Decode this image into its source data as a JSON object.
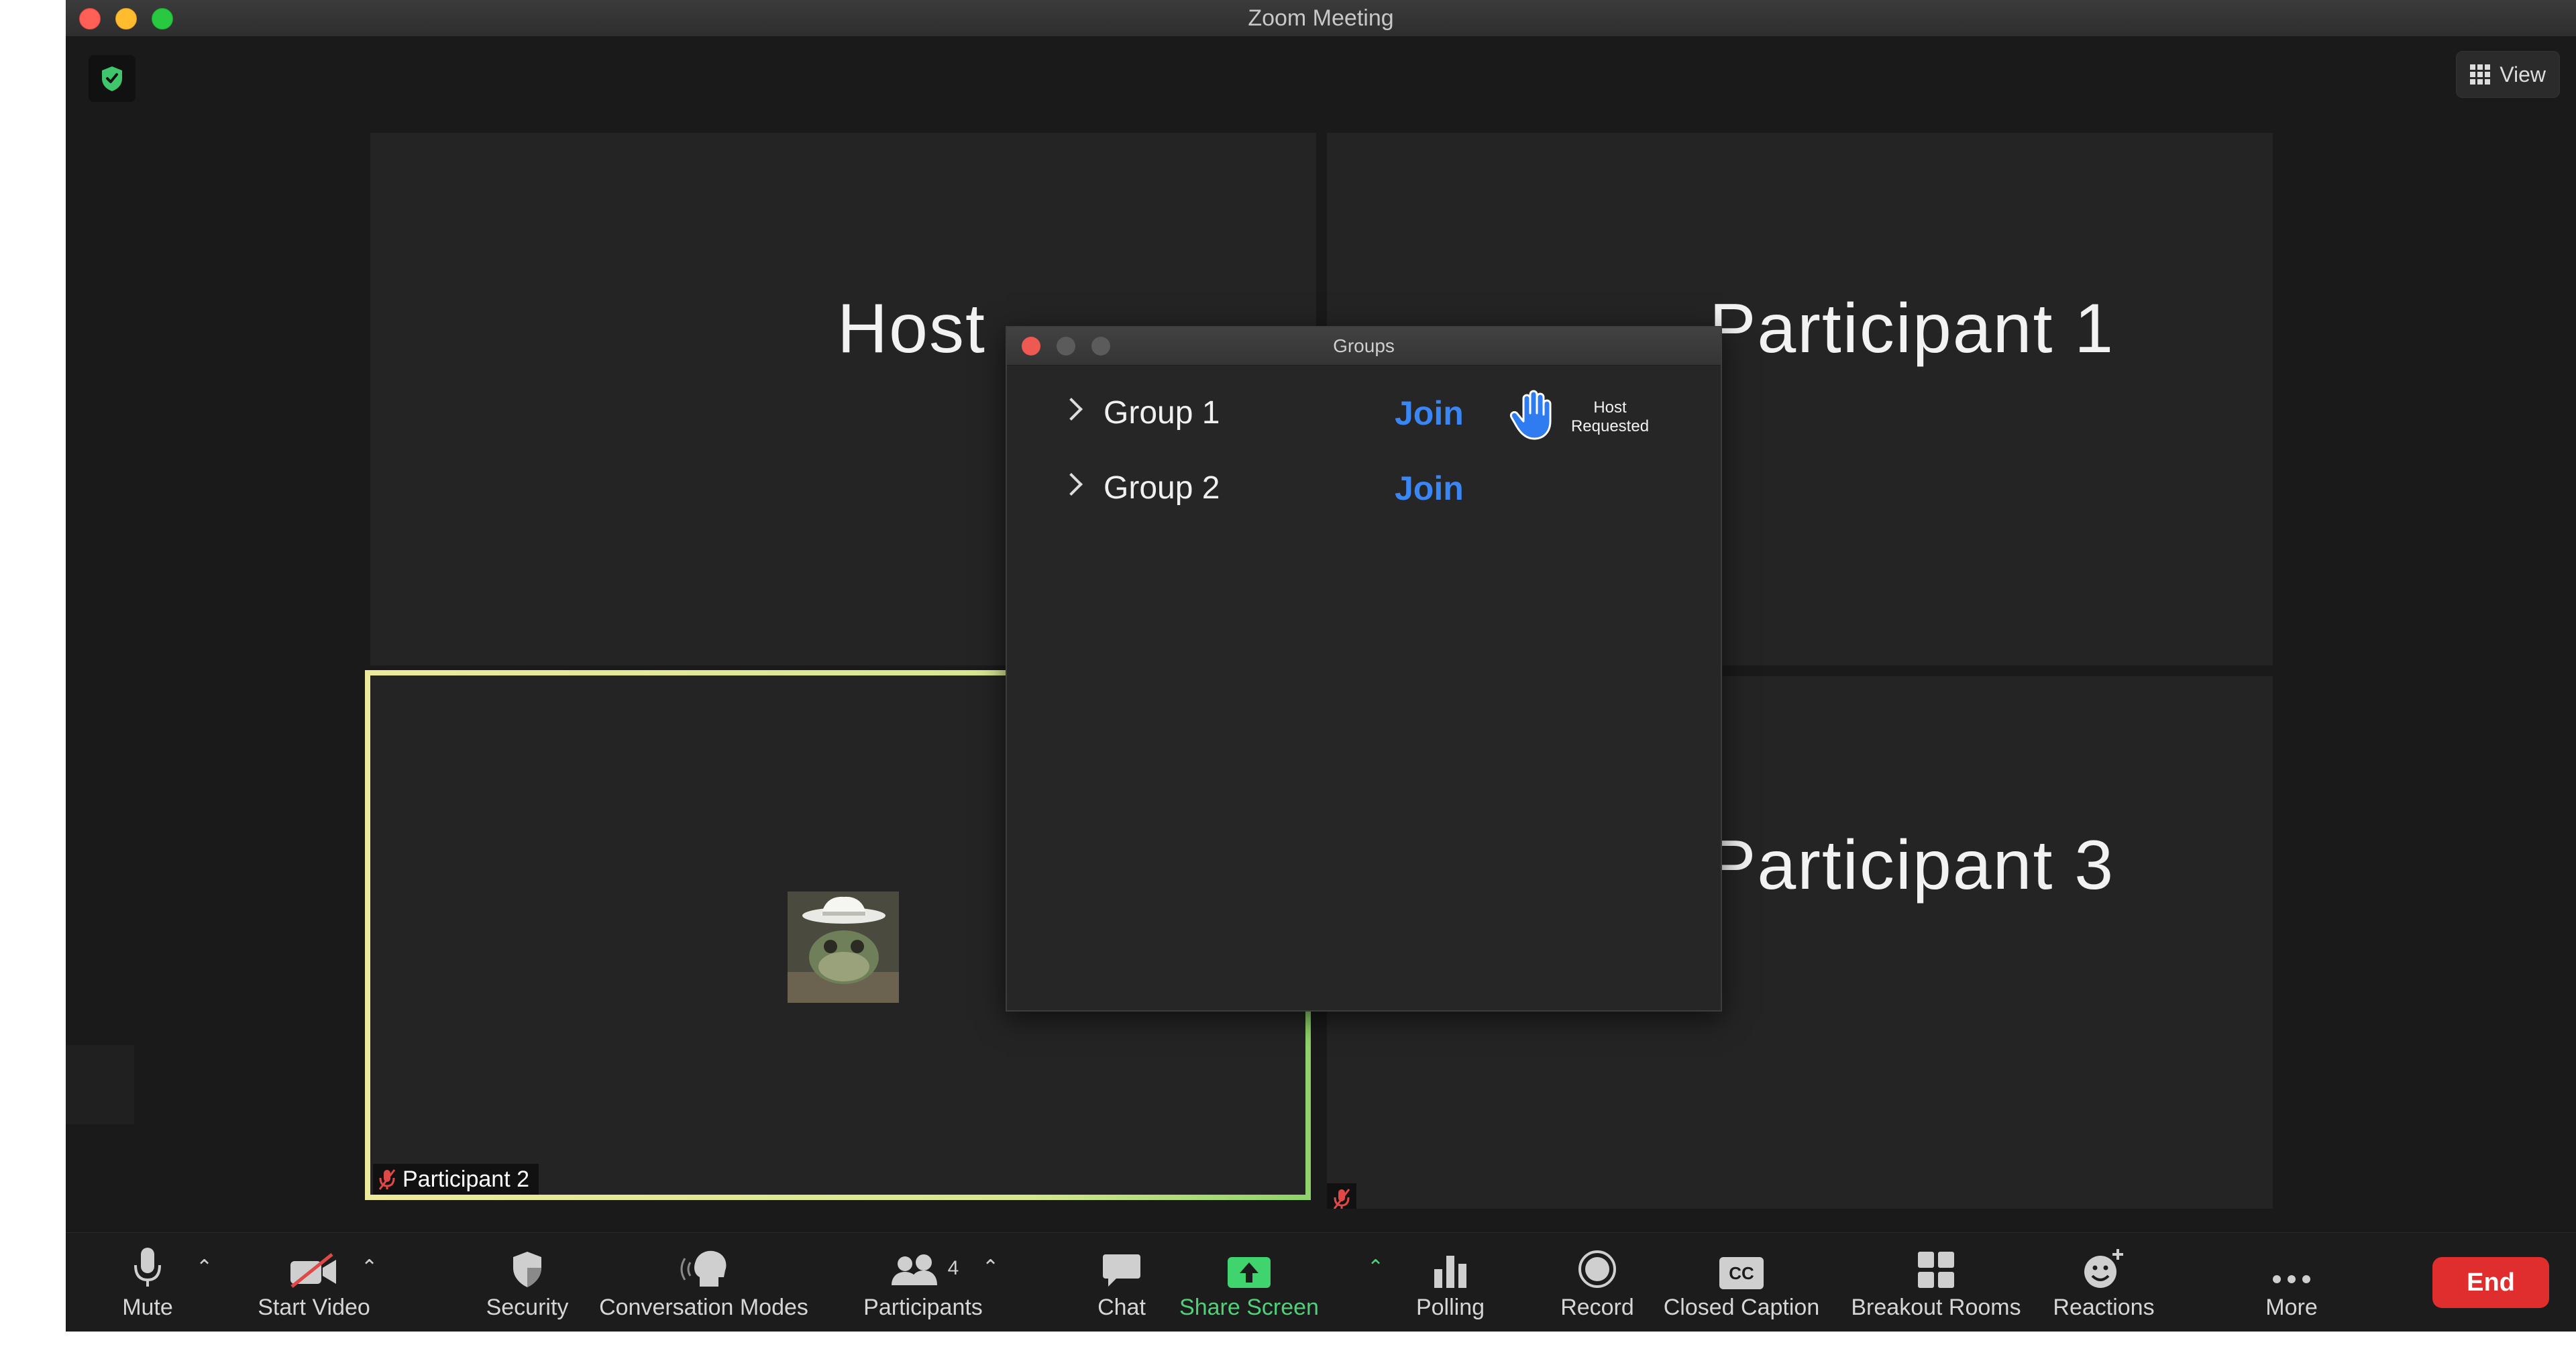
{
  "window": {
    "title": "Zoom Meeting"
  },
  "top_bar": {
    "view_label": "View"
  },
  "tiles": {
    "host": "Host",
    "participant1": "Participant 1",
    "participant2_tag": "Participant 2",
    "participant3": "Participant 3"
  },
  "groups_dialog": {
    "title": "Groups",
    "groups": [
      {
        "name": "Group 1",
        "join_label": "Join",
        "status": "Host Requested"
      },
      {
        "name": "Group 2",
        "join_label": "Join"
      }
    ]
  },
  "toolbar": {
    "mute": "Mute",
    "start_video": "Start Video",
    "security": "Security",
    "conversation_modes": "Conversation Modes",
    "participants": "Participants",
    "participants_count": "4",
    "chat": "Chat",
    "share_screen": "Share Screen",
    "polling": "Polling",
    "record": "Record",
    "closed_caption": "Closed Caption",
    "closed_caption_badge": "CC",
    "breakout_rooms": "Breakout Rooms",
    "reactions": "Reactions",
    "more": "More",
    "end": "End"
  },
  "colors": {
    "accent_blue": "#3a86f5",
    "share_green": "#4fd17a",
    "end_red": "#e02d2d",
    "active_speaker_border": "#e9e58c"
  }
}
